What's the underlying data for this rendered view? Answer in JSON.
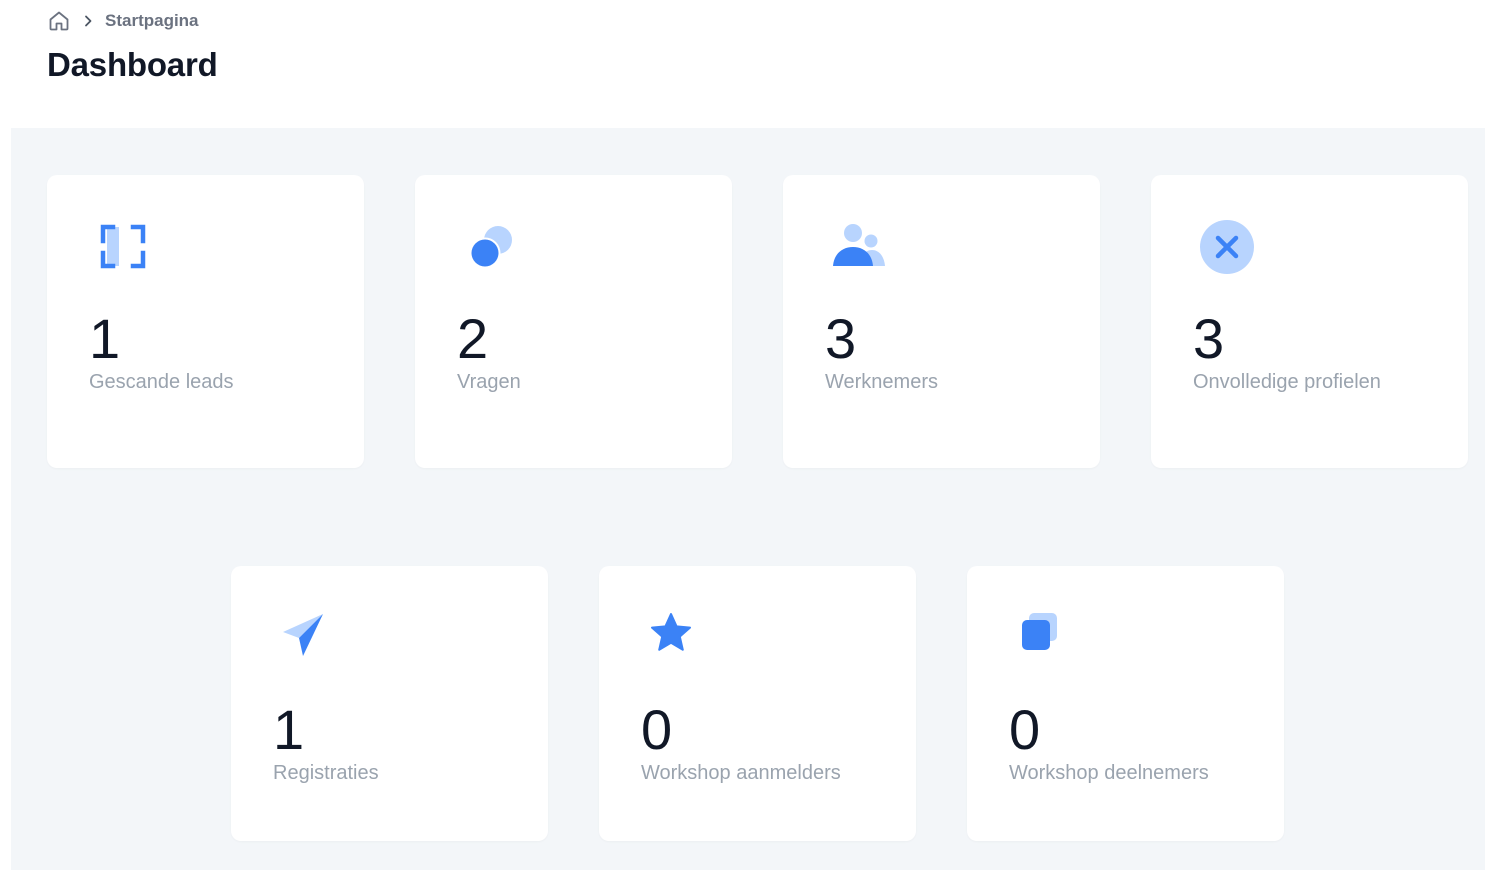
{
  "breadcrumb": {
    "home_icon": "home-icon",
    "separator_icon": "chevron-right-icon",
    "current": "Startpagina"
  },
  "page": {
    "title": "Dashboard"
  },
  "colors": {
    "accent": "#3b82f6",
    "accent_light": "#b8d4fe",
    "background": "#f3f6f9",
    "card": "#ffffff",
    "label": "#9aa3ae",
    "text": "#111827"
  },
  "stats": [
    {
      "value": "1",
      "label": "Gescande leads",
      "icon": "scan-icon"
    },
    {
      "value": "2",
      "label": "Vragen",
      "icon": "questions-icon"
    },
    {
      "value": "3",
      "label": "Werknemers",
      "icon": "users-icon"
    },
    {
      "value": "3",
      "label": "Onvolledige profielen",
      "icon": "x-circle-icon"
    },
    {
      "value": "1",
      "label": "Registraties",
      "icon": "paper-plane-icon"
    },
    {
      "value": "0",
      "label": "Workshop aanmelders",
      "icon": "star-icon"
    },
    {
      "value": "0",
      "label": "Workshop deelnemers",
      "icon": "layers-icon"
    }
  ]
}
